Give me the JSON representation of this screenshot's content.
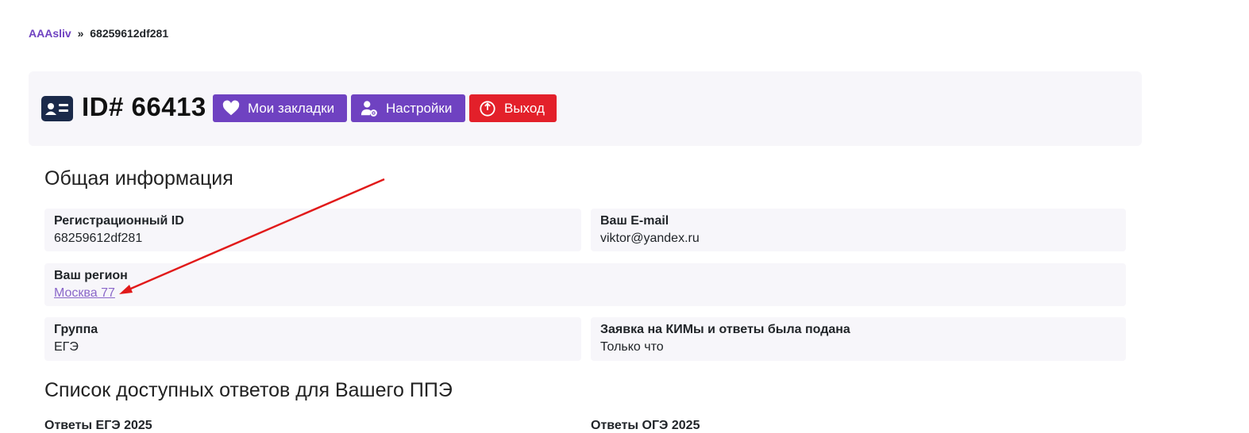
{
  "breadcrumb": {
    "home": "AAAsliv",
    "separator": "»",
    "current": "68259612df281"
  },
  "header": {
    "title": "ID# 66413",
    "icon": "id-card-icon",
    "buttons": {
      "bookmarks": "Мои закладки",
      "settings": "Настройки",
      "logout": "Выход"
    }
  },
  "general": {
    "title": "Общая информация",
    "registration_id": {
      "label": "Регистрационный ID",
      "value": "68259612df281"
    },
    "email": {
      "label": "Ваш E-mail",
      "value": "viktor@yandex.ru"
    },
    "region": {
      "label": "Ваш регион",
      "value": "Москва 77"
    },
    "group": {
      "label": "Группа",
      "value": "ЕГЭ"
    },
    "request": {
      "label": "Заявка на КИМы и ответы была подана",
      "value": "Только что"
    }
  },
  "answers": {
    "title": "Список доступных ответов для Вашего ППЭ",
    "col_ege": "Ответы ЕГЭ 2025",
    "col_oge": "Ответы ОГЭ 2025"
  },
  "colors": {
    "accent": "#6f42c1",
    "danger": "#e3202a",
    "card_bg": "#f7f6fa",
    "annotation_arrow": "#e11a1a"
  }
}
